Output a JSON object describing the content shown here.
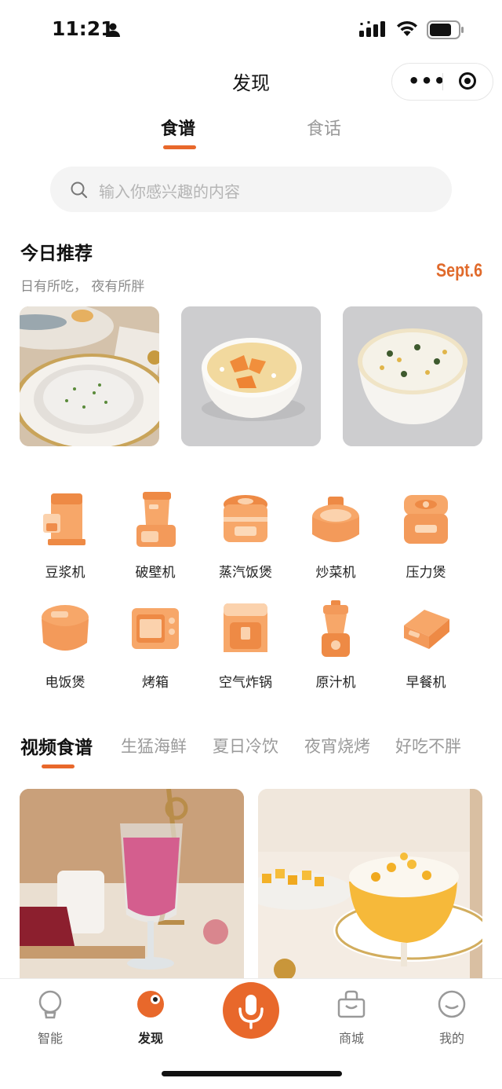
{
  "status": {
    "time": "11:21"
  },
  "nav": {
    "title": "发现"
  },
  "tabs": [
    {
      "label": "食谱"
    },
    {
      "label": "食话"
    }
  ],
  "search": {
    "placeholder": "输入你感兴趣的内容"
  },
  "today": {
    "title": "今日推荐",
    "subtitle": "日有所吃， 夜有所胖",
    "date": "Sept.6"
  },
  "appliances": [
    {
      "label": "豆浆机"
    },
    {
      "label": "破壁机"
    },
    {
      "label": "蒸汽饭煲"
    },
    {
      "label": "炒菜机"
    },
    {
      "label": "压力煲"
    },
    {
      "label": "电饭煲"
    },
    {
      "label": "烤箱"
    },
    {
      "label": "空气炸锅"
    },
    {
      "label": "原汁机"
    },
    {
      "label": "早餐机"
    }
  ],
  "video_tabs": [
    {
      "label": "视频食谱"
    },
    {
      "label": "生猛海鲜"
    },
    {
      "label": "夏日冷饮"
    },
    {
      "label": "夜宵烧烤"
    },
    {
      "label": "好吃不胖"
    }
  ],
  "bottom_tabs": [
    {
      "label": "智能"
    },
    {
      "label": "发现"
    },
    {
      "label": "商城"
    },
    {
      "label": "我的"
    }
  ],
  "colors": {
    "accent": "#e8682b",
    "appliance": "#f39a5a"
  }
}
